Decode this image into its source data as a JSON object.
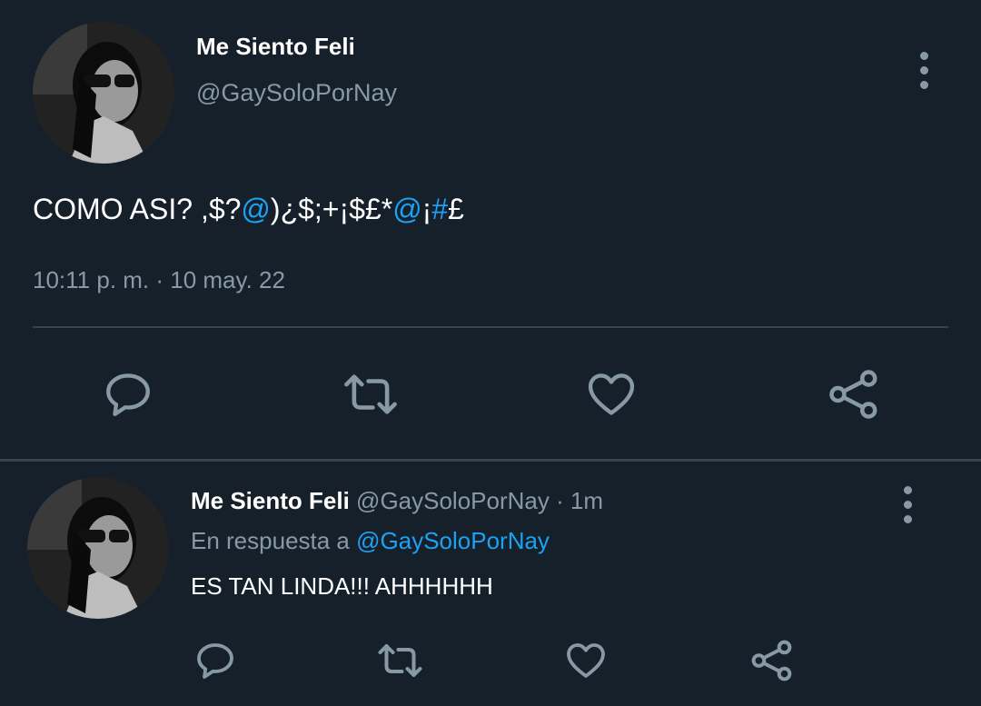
{
  "main_tweet": {
    "author_name": "Me Siento Feli",
    "author_handle": "@GaySoloPorNay",
    "text_parts": [
      {
        "text": "COMO ASI? ,$?",
        "type": "plain"
      },
      {
        "text": "@",
        "type": "link"
      },
      {
        "text": ")¿$;+¡$£*",
        "type": "plain"
      },
      {
        "text": "@",
        "type": "link"
      },
      {
        "text": "¡",
        "type": "plain"
      },
      {
        "text": "#",
        "type": "link"
      },
      {
        "text": "£",
        "type": "plain"
      }
    ],
    "timestamp": "10:11 p. m. · 10 may. 22",
    "actions": [
      "reply-icon",
      "retweet-icon",
      "like-icon",
      "share-icon"
    ]
  },
  "reply_tweet": {
    "author_name": "Me Siento Feli",
    "author_handle": "@GaySoloPorNay",
    "time_ago": "· 1m",
    "reply_prefix": "En respuesta a",
    "reply_to": "@GaySoloPorNay",
    "text": "ES TAN LINDA!!! AHHHHHH",
    "actions": [
      "reply-icon",
      "retweet-icon",
      "like-icon",
      "share-icon"
    ]
  },
  "colors": {
    "background": "#15202b",
    "text": "#ffffff",
    "muted": "#8899a6",
    "link": "#1da1f2",
    "divider": "#38444d"
  }
}
